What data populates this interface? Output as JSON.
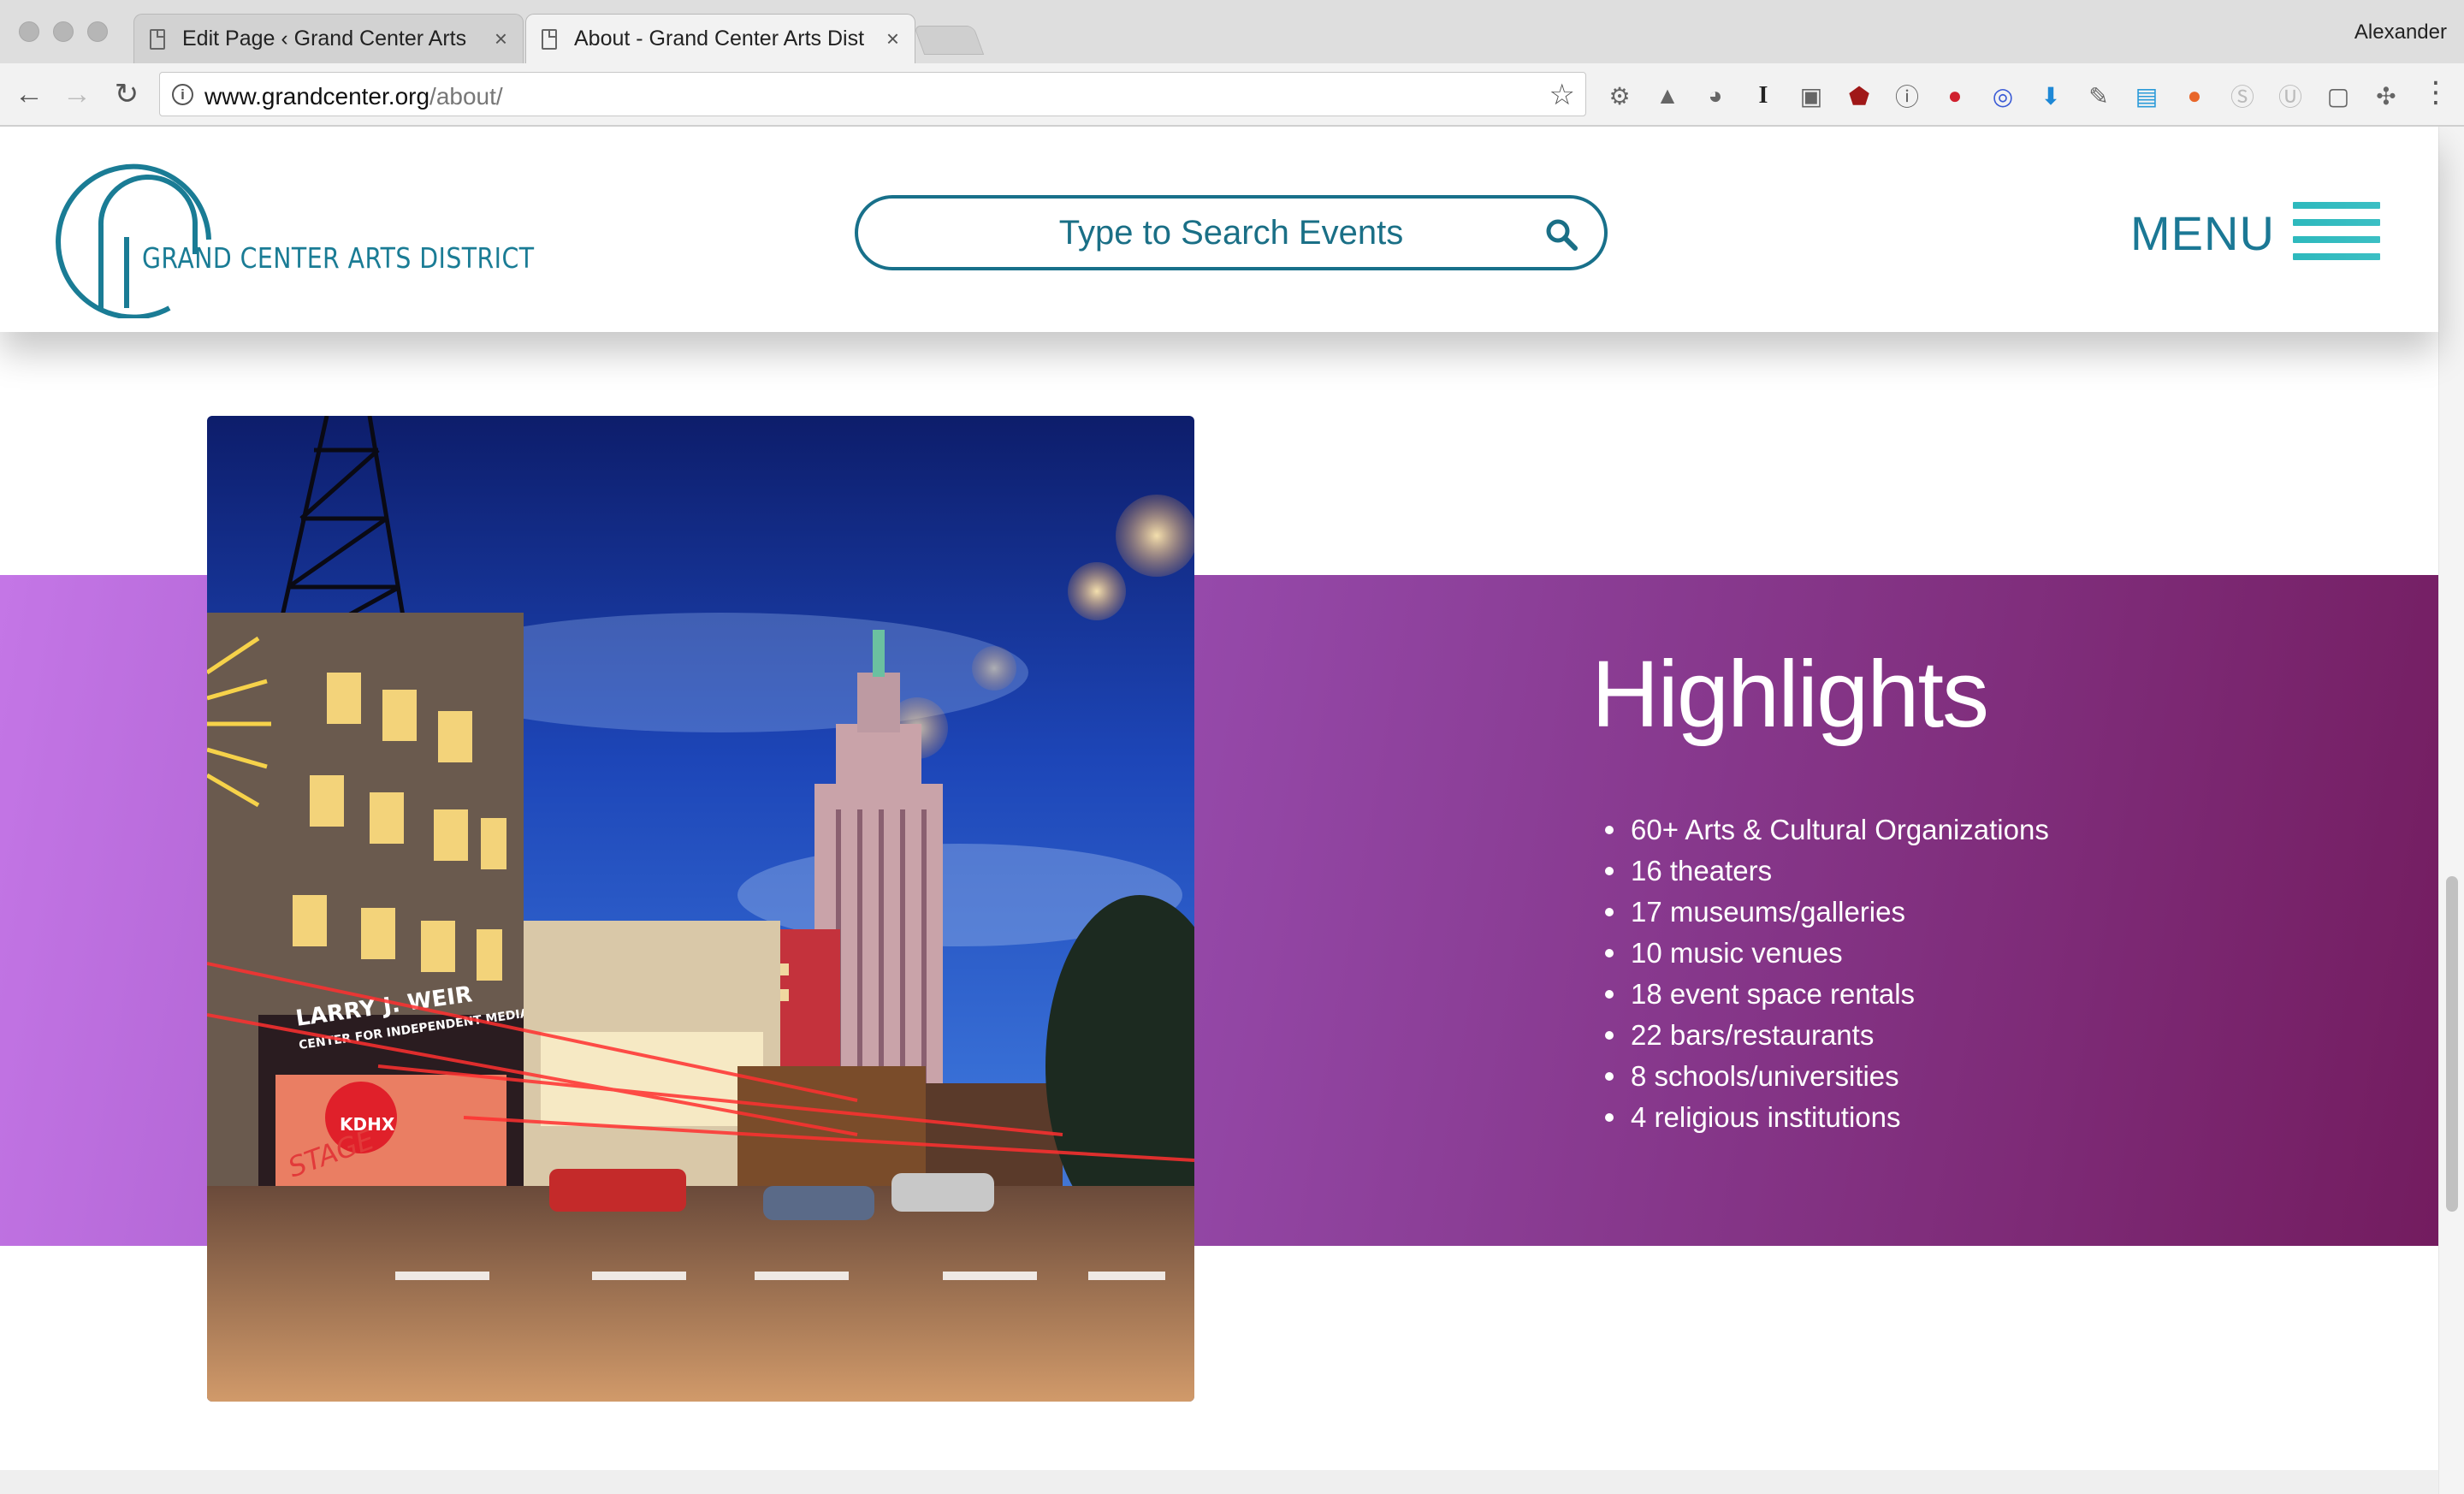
{
  "browser": {
    "tabs": [
      {
        "title": "Edit Page ‹ Grand Center Arts",
        "active": false
      },
      {
        "title": "About - Grand Center Arts Dist",
        "active": true
      }
    ],
    "profile_name": "Alexander",
    "url_host": "www.grandcenter.org",
    "url_path": "/about/",
    "extension_icons": [
      "gear-icon",
      "drive-icon",
      "palette-icon",
      "instapaper-icon",
      "lightbulb-icon",
      "ublock-icon",
      "onepassword-icon",
      "pinterest-icon",
      "target-icon",
      "download-icon",
      "eyedropper-icon",
      "window-icon",
      "colorzilla-icon",
      "skype-icon",
      "circle-u-icon",
      "square-icon",
      "puzzle-icon"
    ]
  },
  "site": {
    "logo_text": "GRAND CENTER ARTS DISTRICT",
    "search_placeholder": "Type to Search Events",
    "menu_label": "MENU",
    "accent_color": "#18708a",
    "menu_bar_color": "#2db9bd"
  },
  "highlights": {
    "title": "Highlights",
    "items": [
      "60+ Arts & Cultural Organizations",
      "16 theaters",
      "17 museums/galleries",
      "10 music venues",
      "18 event space rentals",
      "22 bars/restaurants",
      "8 schools/universities",
      "4 religious institutions"
    ],
    "photo_sign_line1": "LARRY J. WEIR",
    "photo_sign_line2": "CENTER FOR INDEPENDENT MEDIA",
    "photo_sign_stage": "STAGE",
    "photo_sign_kdhx": "KDHX",
    "gradient_start": "#c476e6",
    "gradient_end": "#731c5f"
  }
}
